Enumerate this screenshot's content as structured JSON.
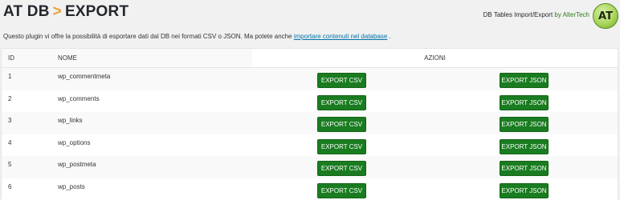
{
  "header": {
    "title_left": "AT DB",
    "separator": ">",
    "title_right": "EXPORT"
  },
  "brand": {
    "plugin_name": "DB Tables Import/Export",
    "by": "by AlterTech",
    "logo_text": "AT"
  },
  "intro": {
    "text": "Questo plugin vi offre la possibilità di esportare dati dal DB nei formati CSV o JSON. Ma potete anche",
    "link": "importare contenuti nel database",
    "suffix": "."
  },
  "table": {
    "columns": {
      "id": "ID",
      "name": "NOME",
      "actions": "AZIONI"
    },
    "csv_label": "EXPORT CSV",
    "json_label": "EXPORT JSON",
    "rows": [
      {
        "id": "1",
        "name": "wp_commentmeta"
      },
      {
        "id": "2",
        "name": "wp_comments"
      },
      {
        "id": "3",
        "name": "wp_links"
      },
      {
        "id": "4",
        "name": "wp_options"
      },
      {
        "id": "5",
        "name": "wp_postmeta"
      },
      {
        "id": "6",
        "name": "wp_posts"
      }
    ]
  },
  "colors": {
    "button_green": "#1a7c20",
    "link_blue": "#0073aa",
    "separator_orange": "#e8a23a"
  }
}
